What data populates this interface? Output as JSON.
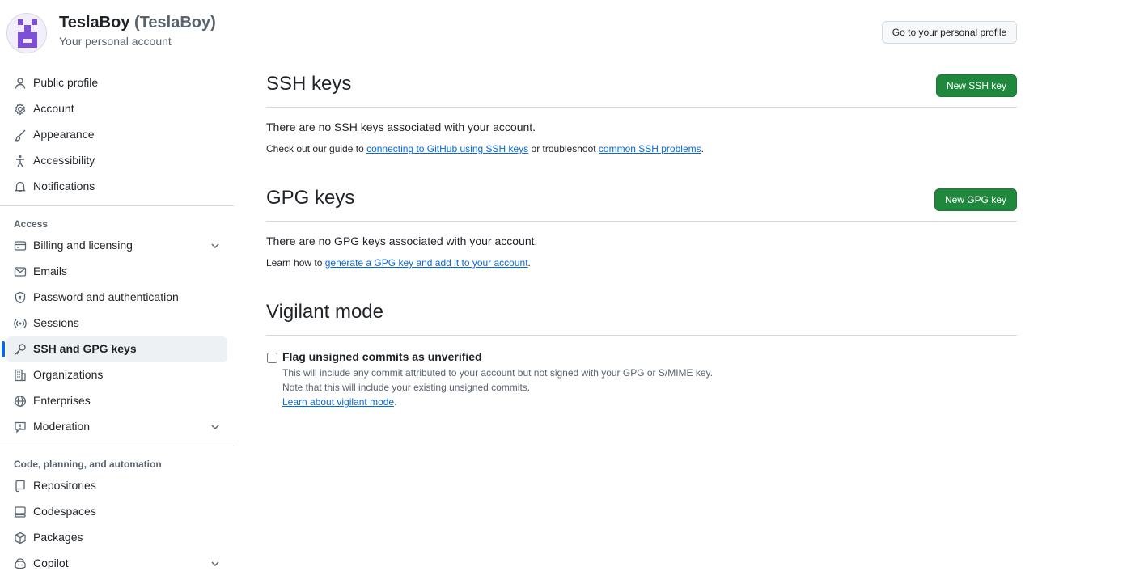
{
  "header": {
    "user_name": "TeslaBoy",
    "user_handle": "(TeslaBoy)",
    "subtitle": "Your personal account",
    "profile_button": "Go to your personal profile"
  },
  "sidebar": {
    "items": [
      {
        "label": "Public profile",
        "icon": "person-icon"
      },
      {
        "label": "Account",
        "icon": "gear-icon"
      },
      {
        "label": "Appearance",
        "icon": "paintbrush-icon"
      },
      {
        "label": "Accessibility",
        "icon": "accessibility-icon"
      },
      {
        "label": "Notifications",
        "icon": "bell-icon"
      }
    ],
    "access_title": "Access",
    "access_items": [
      {
        "label": "Billing and licensing",
        "icon": "credit-card-icon",
        "expandable": true
      },
      {
        "label": "Emails",
        "icon": "mail-icon"
      },
      {
        "label": "Password and authentication",
        "icon": "shield-lock-icon"
      },
      {
        "label": "Sessions",
        "icon": "broadcast-icon"
      },
      {
        "label": "SSH and GPG keys",
        "icon": "key-icon",
        "active": true
      },
      {
        "label": "Organizations",
        "icon": "organization-icon"
      },
      {
        "label": "Enterprises",
        "icon": "globe-icon"
      },
      {
        "label": "Moderation",
        "icon": "report-icon",
        "expandable": true
      }
    ],
    "code_title": "Code, planning, and automation",
    "code_items": [
      {
        "label": "Repositories",
        "icon": "repo-icon"
      },
      {
        "label": "Codespaces",
        "icon": "codespaces-icon"
      },
      {
        "label": "Packages",
        "icon": "package-icon"
      },
      {
        "label": "Copilot",
        "icon": "copilot-icon",
        "expandable": true
      }
    ]
  },
  "ssh": {
    "title": "SSH keys",
    "new_button": "New SSH key",
    "empty": "There are no SSH keys associated with your account.",
    "hint_prefix": "Check out our guide to ",
    "hint_link1": "connecting to GitHub using SSH keys",
    "hint_middle": " or troubleshoot ",
    "hint_link2": "common SSH problems",
    "hint_suffix": "."
  },
  "gpg": {
    "title": "GPG keys",
    "new_button": "New GPG key",
    "empty": "There are no GPG keys associated with your account.",
    "hint_prefix": "Learn how to ",
    "hint_link": "generate a GPG key and add it to your account",
    "hint_suffix": "."
  },
  "vigilant": {
    "title": "Vigilant mode",
    "checkbox_label": "Flag unsigned commits as unverified",
    "checked": false,
    "note1": "This will include any commit attributed to your account but not signed with your GPG or S/MIME key.",
    "note2": "Note that this will include your existing unsigned commits.",
    "learn_link": "Learn about vigilant mode",
    "learn_suffix": "."
  },
  "colors": {
    "accent": "#0969da",
    "primary_button": "#1f883d",
    "active_nav_bg": "#eef1f4"
  }
}
